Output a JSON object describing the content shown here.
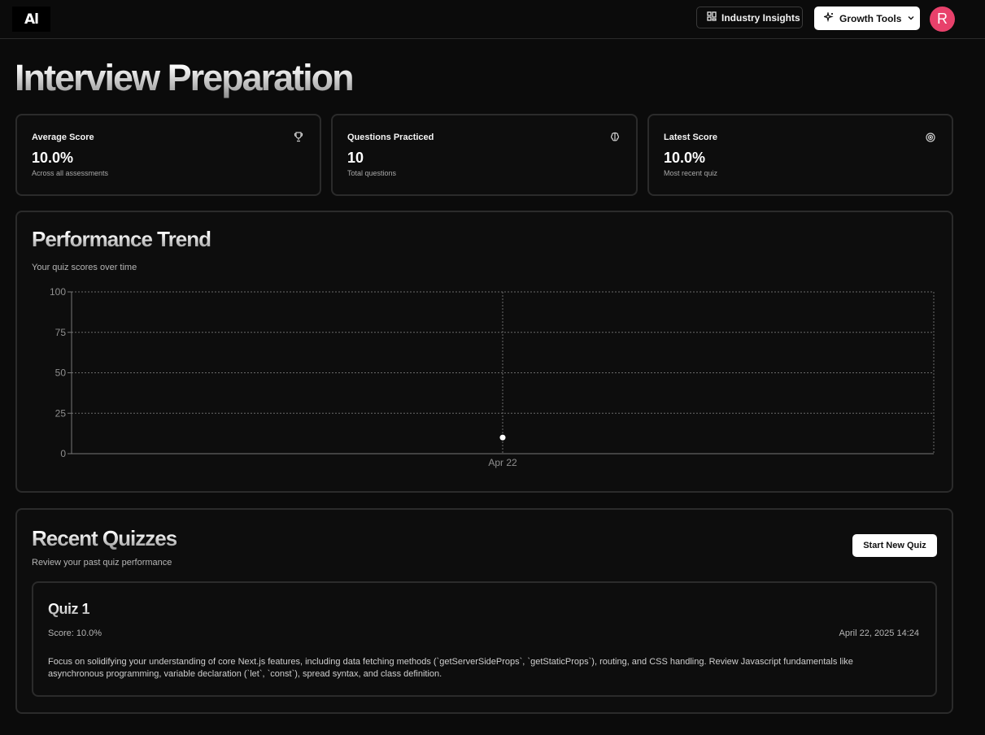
{
  "header": {
    "logo_text": "Al",
    "insights_label": "Industry Insights",
    "growth_label": "Growth Tools",
    "avatar_initial": "R"
  },
  "page_title": "Interview Preparation",
  "stats": [
    {
      "label": "Average Score",
      "value": "10.0%",
      "sub": "Across all assessments",
      "icon": "trophy-icon"
    },
    {
      "label": "Questions Practiced",
      "value": "10",
      "sub": "Total questions",
      "icon": "brain-icon"
    },
    {
      "label": "Latest Score",
      "value": "10.0%",
      "sub": "Most recent quiz",
      "icon": "target-icon"
    }
  ],
  "performance": {
    "title": "Performance Trend",
    "subtitle": "Your quiz scores over time"
  },
  "chart_data": {
    "type": "line",
    "x": [
      "Apr 22"
    ],
    "series": [
      {
        "values": [
          10
        ]
      }
    ],
    "ylim": [
      0,
      100
    ],
    "yticks": [
      0,
      25,
      50,
      75,
      100
    ],
    "grid": true,
    "point_color": "#ffffff"
  },
  "recent": {
    "title": "Recent Quizzes",
    "subtitle": "Review your past quiz performance",
    "start_button": "Start New Quiz",
    "quizzes": [
      {
        "title": "Quiz 1",
        "score": "Score: 10.0%",
        "date": "April 22, 2025 14:24",
        "description": "Focus on solidifying your understanding of core Next.js features, including data fetching methods (`getServerSideProps`, `getStaticProps`), routing, and CSS handling. Review Javascript fundamentals like asynchronous programming, variable declaration (`let`, `const`), spread syntax, and class definition."
      }
    ]
  },
  "colors": {
    "background": "#0b0b0b",
    "avatar": "#e8416b",
    "card_border": "#2b2b2b"
  }
}
